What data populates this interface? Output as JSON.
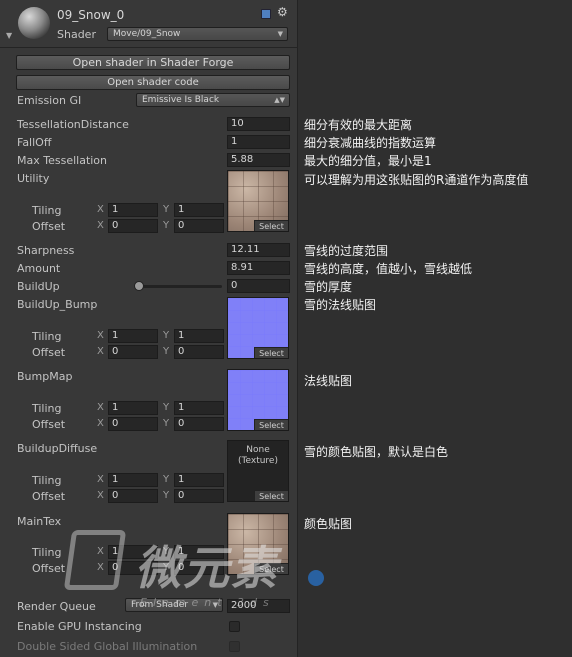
{
  "header": {
    "material_name": "09_Snow_0",
    "shader_label": "Shader",
    "shader_value": "Move/09_Snow"
  },
  "buttons": {
    "open_forge": "Open shader in Shader Forge",
    "open_code": "Open shader code"
  },
  "emission": {
    "label": "Emission GI",
    "value": "Emissive Is Black"
  },
  "props": {
    "tess_distance": {
      "label": "TessellationDistance",
      "value": "10",
      "note": "细分有效的最大距离"
    },
    "falloff": {
      "label": "FallOff",
      "value": "1",
      "note": "细分衰减曲线的指数运算"
    },
    "max_tess": {
      "label": "Max Tessellation",
      "value": "5.88",
      "note": "最大的细分值，最小是1"
    },
    "utility": {
      "label": "Utility",
      "note": "可以理解为用这张贴图的R通道作为高度值",
      "tiling": {
        "x": "1",
        "y": "1"
      },
      "offset": {
        "x": "0",
        "y": "0"
      }
    },
    "sharpness": {
      "label": "Sharpness",
      "value": "12.11",
      "note": "雪线的过度范围"
    },
    "amount": {
      "label": "Amount",
      "value": "8.91",
      "note": "雪线的高度，值越小，雪线越低"
    },
    "buildup": {
      "label": "BuildUp",
      "value": "0",
      "note": "雪的厚度"
    },
    "buildup_bump": {
      "label": "BuildUp_Bump",
      "note": "雪的法线贴图",
      "tiling": {
        "x": "1",
        "y": "1"
      },
      "offset": {
        "x": "0",
        "y": "0"
      }
    },
    "bumpmap": {
      "label": "BumpMap",
      "note": "法线贴图",
      "tiling": {
        "x": "1",
        "y": "1"
      },
      "offset": {
        "x": "0",
        "y": "0"
      }
    },
    "buildup_diffuse": {
      "label": "BuildupDiffuse",
      "note": "雪的颜色贴图，默认是白色",
      "none_line1": "None",
      "none_line2": "(Texture)",
      "tiling": {
        "x": "1",
        "y": "1"
      },
      "offset": {
        "x": "0",
        "y": "0"
      }
    },
    "maintex": {
      "label": "MainTex",
      "note": "颜色贴图",
      "tiling": {
        "x": "1",
        "y": "1"
      },
      "offset": {
        "x": "0",
        "y": "0"
      }
    }
  },
  "labels": {
    "tiling": "Tiling",
    "offset": "Offset",
    "x": "X",
    "y": "Y",
    "select": "Select"
  },
  "footer": {
    "render_queue_label": "Render Queue",
    "render_queue_mode": "From Shader",
    "render_queue_value": "2000",
    "gpu_instancing": "Enable GPU Instancing",
    "double_sided": "Double Sided Global Illumination"
  },
  "watermark": {
    "text": "微元素",
    "sub": "Element 3ds"
  }
}
